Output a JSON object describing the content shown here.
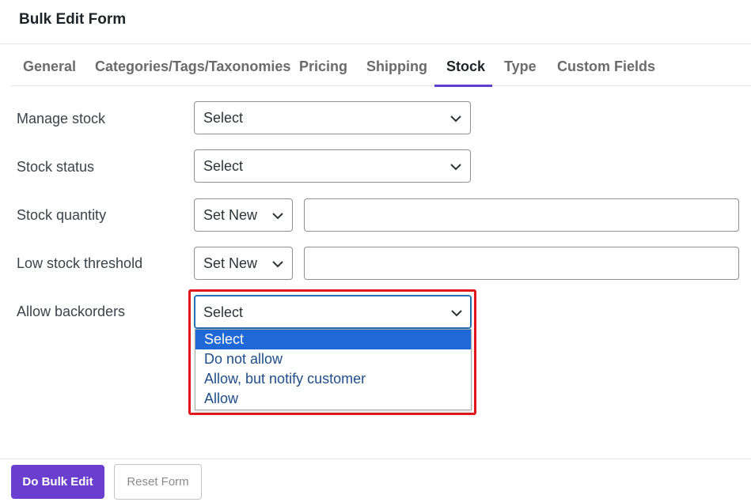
{
  "header": {
    "title": "Bulk Edit Form"
  },
  "tabs": [
    {
      "label": "General"
    },
    {
      "label": "Categories/Tags/Taxonomies"
    },
    {
      "label": "Pricing"
    },
    {
      "label": "Shipping"
    },
    {
      "label": "Stock",
      "active": true
    },
    {
      "label": "Type"
    },
    {
      "label": "Custom Fields"
    }
  ],
  "form": {
    "manage_stock": {
      "label": "Manage stock",
      "value": "Select"
    },
    "stock_status": {
      "label": "Stock status",
      "value": "Select"
    },
    "stock_quantity": {
      "label": "Stock quantity",
      "mode": "Set New",
      "value": ""
    },
    "low_stock_threshold": {
      "label": "Low stock threshold",
      "mode": "Set New",
      "value": ""
    },
    "allow_backorders": {
      "label": "Allow backorders",
      "value": "Select",
      "options": [
        "Select",
        "Do not allow",
        "Allow, but notify customer",
        "Allow"
      ],
      "highlighted_option": "Select"
    }
  },
  "footer": {
    "primary_label": "Do Bulk Edit",
    "secondary_label": "Reset Form"
  },
  "colors": {
    "accent": "#6a3fd0",
    "tab_underline": "#5a3fd1",
    "highlight_border": "#e3161b",
    "option_selected_bg": "#1e68d8"
  }
}
